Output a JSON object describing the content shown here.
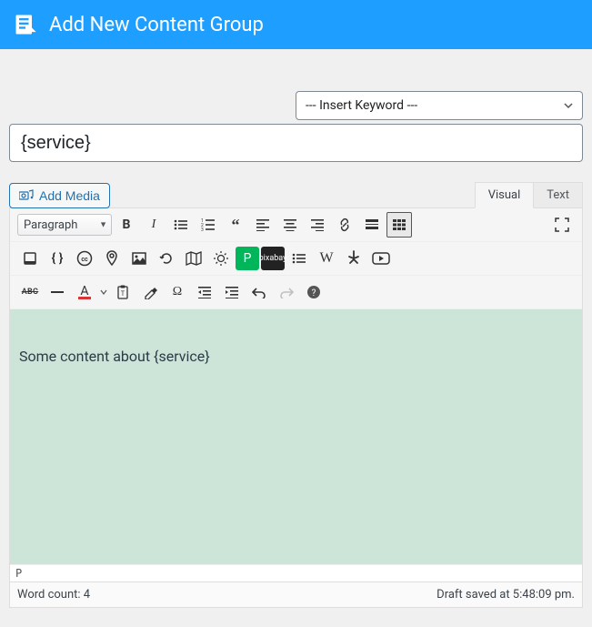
{
  "header": {
    "title": "Add New Content Group"
  },
  "insert_keyword": {
    "placeholder": "--- Insert Keyword ---"
  },
  "title_input": {
    "value": "{service}"
  },
  "media_button": {
    "label": "Add Media"
  },
  "tabs": {
    "visual": "Visual",
    "text": "Text"
  },
  "toolbar": {
    "paragraph": "Paragraph",
    "abc": "ABC",
    "pexels": "P",
    "pixabay": "pixabay",
    "wiki": "W",
    "omega": "Ω",
    "help": "?"
  },
  "editor": {
    "content": "Some content about {service}"
  },
  "status": {
    "path": "P"
  },
  "footer": {
    "word_count": "Word count: 4",
    "draft_saved": "Draft saved at 5:48:09 pm."
  }
}
